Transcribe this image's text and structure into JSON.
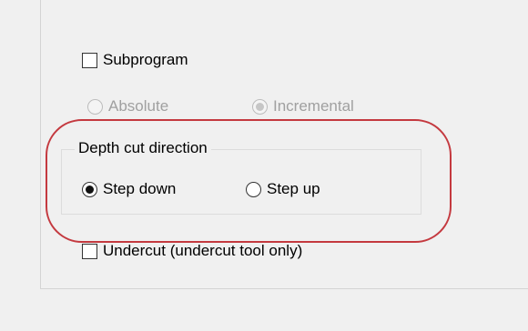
{
  "options": {
    "subprogram": {
      "label": "Subprogram",
      "checked": false
    },
    "mode_radios": [
      {
        "label": "Absolute",
        "selected": false,
        "enabled": false
      },
      {
        "label": "Incremental",
        "selected": true,
        "enabled": false
      }
    ],
    "undercut": {
      "label": "Undercut (undercut tool only)",
      "checked": false
    }
  },
  "depth_cut_direction": {
    "title": "Depth cut direction",
    "radios": [
      {
        "label": "Step down",
        "selected": true
      },
      {
        "label": "Step up",
        "selected": false
      }
    ]
  },
  "colors": {
    "highlight": "#c4393f",
    "panel_bg": "#f0f0f0"
  }
}
